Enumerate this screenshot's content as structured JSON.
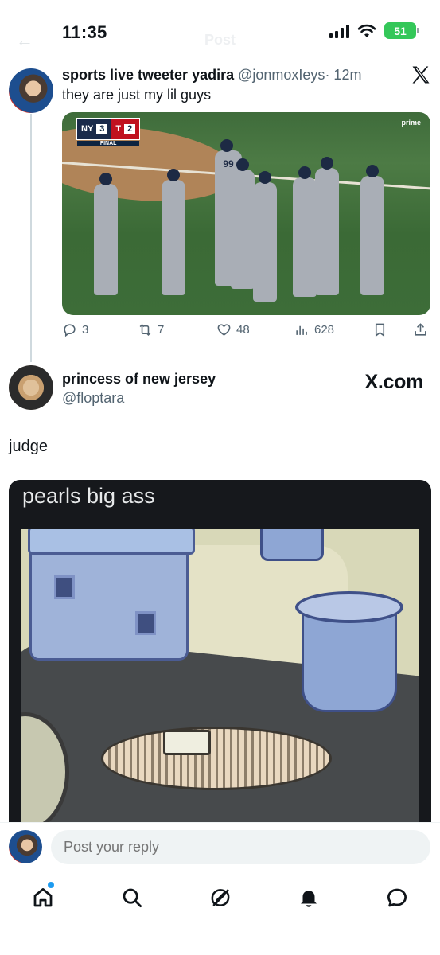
{
  "status_bar": {
    "time": "11:35",
    "battery": "51"
  },
  "header": {
    "title": "Post"
  },
  "tweet1": {
    "author_name": "sports live tweeter yadira",
    "handle": "@jonmoxIeys",
    "time": "· 12m",
    "text": "they are just my lil guys",
    "media": {
      "scorebug": {
        "team1_score": "3",
        "team2_score": "2",
        "status": "FINAL"
      },
      "network": "prime",
      "jersey_number": "99"
    },
    "stats": {
      "replies": "3",
      "reposts": "7",
      "likes": "48",
      "views": "628"
    }
  },
  "tweet2": {
    "author_name": "princess of new jersey",
    "handle": "@floptara",
    "watermark": "X.com",
    "text": "judge",
    "media_caption": "pearls big ass"
  },
  "reply": {
    "placeholder": "Post your reply"
  },
  "nav": {
    "items": [
      "home-icon",
      "search-icon",
      "grok-icon",
      "notifications-icon",
      "messages-icon"
    ],
    "accent": "#1d9bf0"
  }
}
